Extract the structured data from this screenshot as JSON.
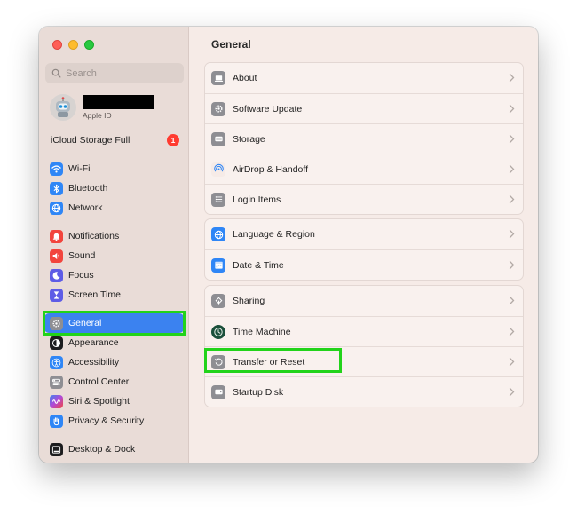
{
  "sidebar": {
    "search_placeholder": "Search",
    "account": {
      "subtitle": "Apple ID"
    },
    "icloud": {
      "label": "iCloud Storage Full",
      "badge": "1"
    },
    "groups": [
      {
        "items": [
          {
            "label": "Wi-Fi",
            "icon": "wifi-icon"
          },
          {
            "label": "Bluetooth",
            "icon": "bluetooth-icon"
          },
          {
            "label": "Network",
            "icon": "globe-icon"
          }
        ]
      },
      {
        "items": [
          {
            "label": "Notifications",
            "icon": "bell-icon"
          },
          {
            "label": "Sound",
            "icon": "speaker-icon"
          },
          {
            "label": "Focus",
            "icon": "moon-icon"
          },
          {
            "label": "Screen Time",
            "icon": "hourglass-icon"
          }
        ]
      },
      {
        "items": [
          {
            "label": "General",
            "icon": "gear-icon",
            "selected": true
          },
          {
            "label": "Appearance",
            "icon": "appearance-icon"
          },
          {
            "label": "Accessibility",
            "icon": "accessibility-icon"
          },
          {
            "label": "Control Center",
            "icon": "control-center-icon"
          },
          {
            "label": "Siri & Spotlight",
            "icon": "siri-icon"
          },
          {
            "label": "Privacy & Security",
            "icon": "hand-icon"
          }
        ]
      },
      {
        "items": [
          {
            "label": "Desktop & Dock",
            "icon": "dock-icon"
          }
        ]
      }
    ]
  },
  "main": {
    "title": "General",
    "groups": [
      {
        "rows": [
          {
            "label": "About",
            "icon": "laptop-icon"
          },
          {
            "label": "Software Update",
            "icon": "gear-badge-icon"
          },
          {
            "label": "Storage",
            "icon": "drive-icon"
          },
          {
            "label": "AirDrop & Handoff",
            "icon": "airdrop-icon"
          },
          {
            "label": "Login Items",
            "icon": "list-icon"
          }
        ]
      },
      {
        "rows": [
          {
            "label": "Language & Region",
            "icon": "globe-icon"
          },
          {
            "label": "Date & Time",
            "icon": "calendar-icon"
          }
        ]
      },
      {
        "rows": [
          {
            "label": "Sharing",
            "icon": "sharing-icon"
          },
          {
            "label": "Time Machine",
            "icon": "time-machine-icon"
          },
          {
            "label": "Transfer or Reset",
            "icon": "reset-icon"
          },
          {
            "label": "Startup Disk",
            "icon": "disk-icon"
          }
        ]
      }
    ]
  },
  "colors": {
    "highlight": "#22d31a",
    "selection": "#3b82f0",
    "badge": "#ff3b30"
  }
}
